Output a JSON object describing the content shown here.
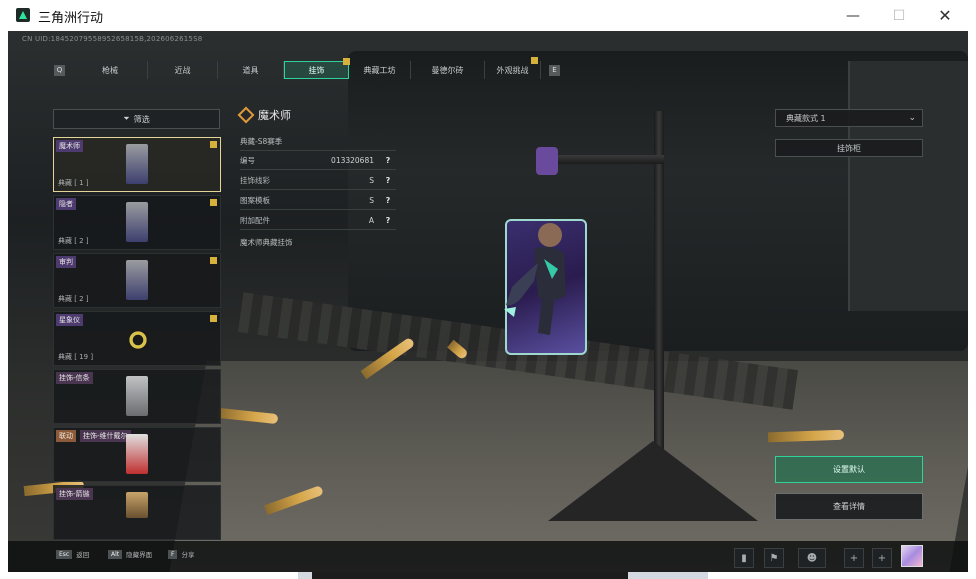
{
  "window": {
    "title": "三角洲行动",
    "minimize_glyph": "—",
    "maximize_glyph": "☐",
    "close_glyph": "✕"
  },
  "game": {
    "uid_text": "CN UID:1845207955895265815B,2026062615S8",
    "tabs": {
      "key_left": "Q",
      "key_right": "E",
      "items": [
        "枪械",
        "近战",
        "道具",
        "挂饰",
        "典藏工坊",
        "曼德尔砖",
        "外观挑战"
      ],
      "active_index": 3
    },
    "filter": {
      "label": "筛选"
    },
    "list_items": [
      {
        "name": "魔术师",
        "count": "典藏 [ 1 ]"
      },
      {
        "name": "隐者",
        "count": "典藏 [ 2 ]"
      },
      {
        "name": "审判",
        "count": "典藏 [ 2 ]"
      },
      {
        "name": "星象仪",
        "count": "典藏 [ 19 ]"
      },
      {
        "name": "挂饰-信条",
        "count": ""
      },
      {
        "prefix": "联动",
        "name": "挂饰-维什戴尔",
        "count": ""
      },
      {
        "name": "挂饰-箭镞",
        "count": ""
      }
    ],
    "detail": {
      "title": "魔术师",
      "rows": [
        {
          "label": "典藏-S8赛季",
          "value": "",
          "help": ""
        },
        {
          "label": "编号",
          "value": "013320681",
          "help": "?"
        },
        {
          "label": "挂饰线彩",
          "value": "S",
          "help": "?"
        },
        {
          "label": "图案模板",
          "value": "S",
          "help": "?"
        },
        {
          "label": "附加配件",
          "value": "A",
          "help": "?"
        },
        {
          "label": "魔术师典藏挂饰",
          "value": "",
          "help": ""
        }
      ]
    },
    "right_panel": {
      "select_value": "典藏款式 1",
      "button_label": "挂饰柜",
      "primary_label": "设置默认",
      "secondary_label": "查看详情"
    },
    "bottom": {
      "hints": [
        {
          "key": "Esc",
          "label": "返回"
        },
        {
          "key": "Alt",
          "label": "隐藏界面"
        },
        {
          "key": "F",
          "label": "分享"
        }
      ],
      "tool_icons": [
        "stats-icon",
        "pin-icon",
        "people-icon",
        "plus-icon",
        "plus-icon"
      ]
    }
  }
}
